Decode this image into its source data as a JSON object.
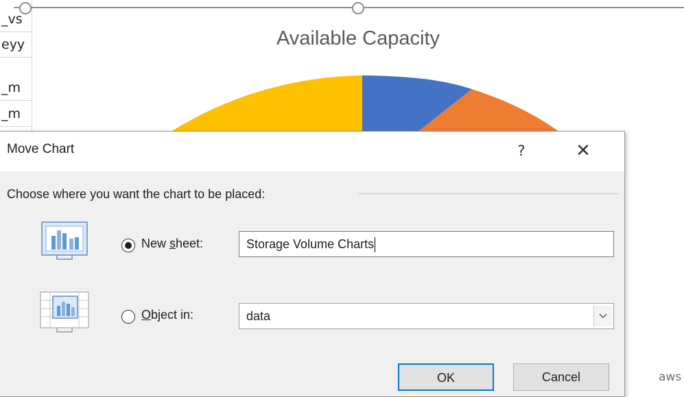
{
  "sheet": {
    "cells": [
      "_vs",
      "eyy",
      "_m",
      "_m"
    ]
  },
  "chart": {
    "title": "Available Capacity",
    "partial_label": "aws",
    "colors": {
      "yellow": "#FFC000",
      "blue": "#4472C4",
      "orange": "#ED7D31"
    }
  },
  "dialog": {
    "title": "Move Chart",
    "help_label": "?",
    "close_label": "✕",
    "group_label": "Choose where you want the chart to be placed:",
    "new_sheet": {
      "label_pre": "New ",
      "label_mnemonic": "s",
      "label_post": "heet:",
      "value": "Storage Volume Charts",
      "checked": true
    },
    "object_in": {
      "label_mnemonic": "O",
      "label_post": "bject in:",
      "value": "data",
      "checked": false
    },
    "ok_label": "OK",
    "cancel_label": "Cancel"
  },
  "icons": {
    "new_sheet_icon": "chart-sheet-icon",
    "object_in_icon": "embedded-chart-icon",
    "dropdown_icon": "chevron-down-icon"
  }
}
